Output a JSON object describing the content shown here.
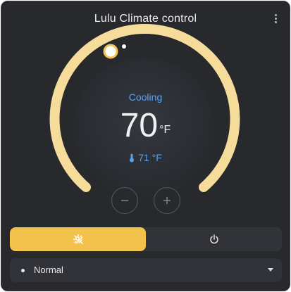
{
  "card": {
    "title": "Lulu Climate control",
    "menu_icon": "more-vertical-icon"
  },
  "dial": {
    "mode_text": "Cooling",
    "target_value": "70",
    "target_unit": "°F",
    "current_label": "71 °F",
    "current_icon": "thermometer-icon",
    "decrease_icon": "minus-icon",
    "increase_icon": "plus-icon"
  },
  "modes": {
    "items": [
      {
        "icon": "heat-cool-icon",
        "active": true
      },
      {
        "icon": "power-icon",
        "active": false
      }
    ]
  },
  "preset": {
    "selected": "Normal"
  },
  "colors": {
    "accent": "#f2c24d",
    "arc": "#f6dc9b",
    "cooling": "#5aa2ec",
    "card": "#28292d"
  }
}
